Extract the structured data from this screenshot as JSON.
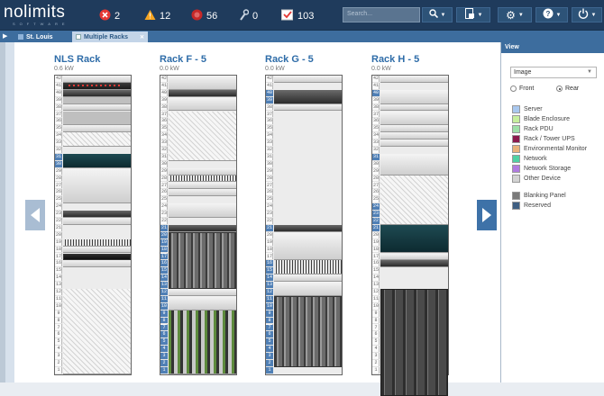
{
  "app": {
    "logo": "nolimits",
    "logo_sub": "SOFTWARE"
  },
  "topbar": {
    "stats": [
      {
        "icon": "critical-alarm-icon",
        "value": "2",
        "color": "#e53935"
      },
      {
        "icon": "warning-icon",
        "value": "12",
        "color": "#f6a623"
      },
      {
        "icon": "minor-alarm-icon",
        "value": "56",
        "color": "#c62828"
      },
      {
        "icon": "wrench-icon",
        "value": "0",
        "color": "#c9d4e0"
      },
      {
        "icon": "checked-task-icon",
        "value": "103",
        "color": "#e53935"
      }
    ],
    "search_placeholder": "Search..."
  },
  "tabs": [
    {
      "label": "St. Louis",
      "active": false
    },
    {
      "label": "Multiple Racks",
      "active": true
    }
  ],
  "racks": [
    {
      "name": "NLS Rack",
      "power": "0.6 kW"
    },
    {
      "name": "Rack F - 5",
      "power": "0.0 kW"
    },
    {
      "name": "Rack G - 5",
      "power": "0.0 kW"
    },
    {
      "name": "Rack H - 5",
      "power": "0.0 kW"
    }
  ],
  "view_panel": {
    "title": "View",
    "mode": "Image",
    "face_options": [
      "Front",
      "Rear"
    ],
    "face_selected": "Rear",
    "legend": [
      {
        "label": "Server",
        "color": "#a9c8ef"
      },
      {
        "label": "Blade Enclosure",
        "color": "#c6ef9e"
      },
      {
        "label": "Rack PDU",
        "color": "#9de0a8"
      },
      {
        "label": "Rack / Tower UPS",
        "color": "#8b1a4e"
      },
      {
        "label": "Environmental Monitor",
        "color": "#e8b27a"
      },
      {
        "label": "Network",
        "color": "#4fd1a3"
      },
      {
        "label": "Network Storage",
        "color": "#b07be0"
      },
      {
        "label": "Other Device",
        "color": "#d3d3d3"
      }
    ],
    "legend2": [
      {
        "label": "Blanking Panel",
        "color": "#7a7a7a"
      },
      {
        "label": "Reserved",
        "color": "#3f5f82"
      }
    ]
  }
}
